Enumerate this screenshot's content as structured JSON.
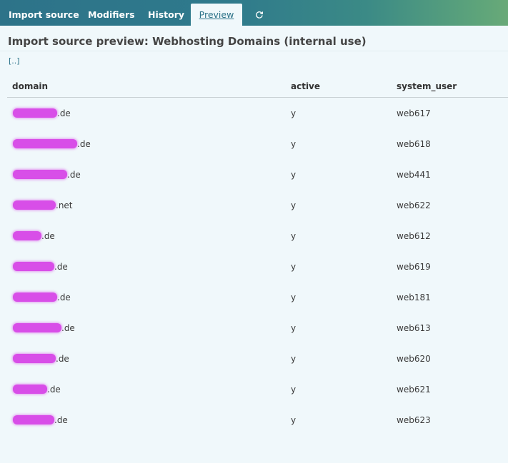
{
  "tabs": [
    {
      "label": "Import source",
      "active": false
    },
    {
      "label": "Modifiers",
      "active": false
    },
    {
      "label": "History",
      "active": false
    },
    {
      "label": "Preview",
      "active": true
    }
  ],
  "refresh_icon": "refresh-icon",
  "page": {
    "title": "Import source preview: Webhosting Domains (internal use)",
    "breadcrumb": "[..]"
  },
  "table": {
    "columns": [
      "domain",
      "active",
      "system_user"
    ],
    "rows": [
      {
        "domain_suffix": ".de",
        "active": "y",
        "system_user": "web617"
      },
      {
        "domain_suffix": ".de",
        "active": "y",
        "system_user": "web618"
      },
      {
        "domain_suffix": ".de",
        "active": "y",
        "system_user": "web441"
      },
      {
        "domain_suffix": ".net",
        "active": "y",
        "system_user": "web622"
      },
      {
        "domain_suffix": ".de",
        "active": "y",
        "system_user": "web612"
      },
      {
        "domain_suffix": ".de",
        "active": "y",
        "system_user": "web619"
      },
      {
        "domain_suffix": ".de",
        "active": "y",
        "system_user": "web181"
      },
      {
        "domain_suffix": ".de",
        "active": "y",
        "system_user": "web613"
      },
      {
        "domain_suffix": ".de",
        "active": "y",
        "system_user": "web620"
      },
      {
        "domain_suffix": ".de",
        "active": "y",
        "system_user": "web621"
      },
      {
        "domain_suffix": ".de",
        "active": "y",
        "system_user": "web623"
      }
    ]
  },
  "colors": {
    "header_gradient_start": "#2d7389",
    "header_gradient_end": "#69a978",
    "background": "#f0f8fb",
    "redaction": "#d84ee8"
  }
}
